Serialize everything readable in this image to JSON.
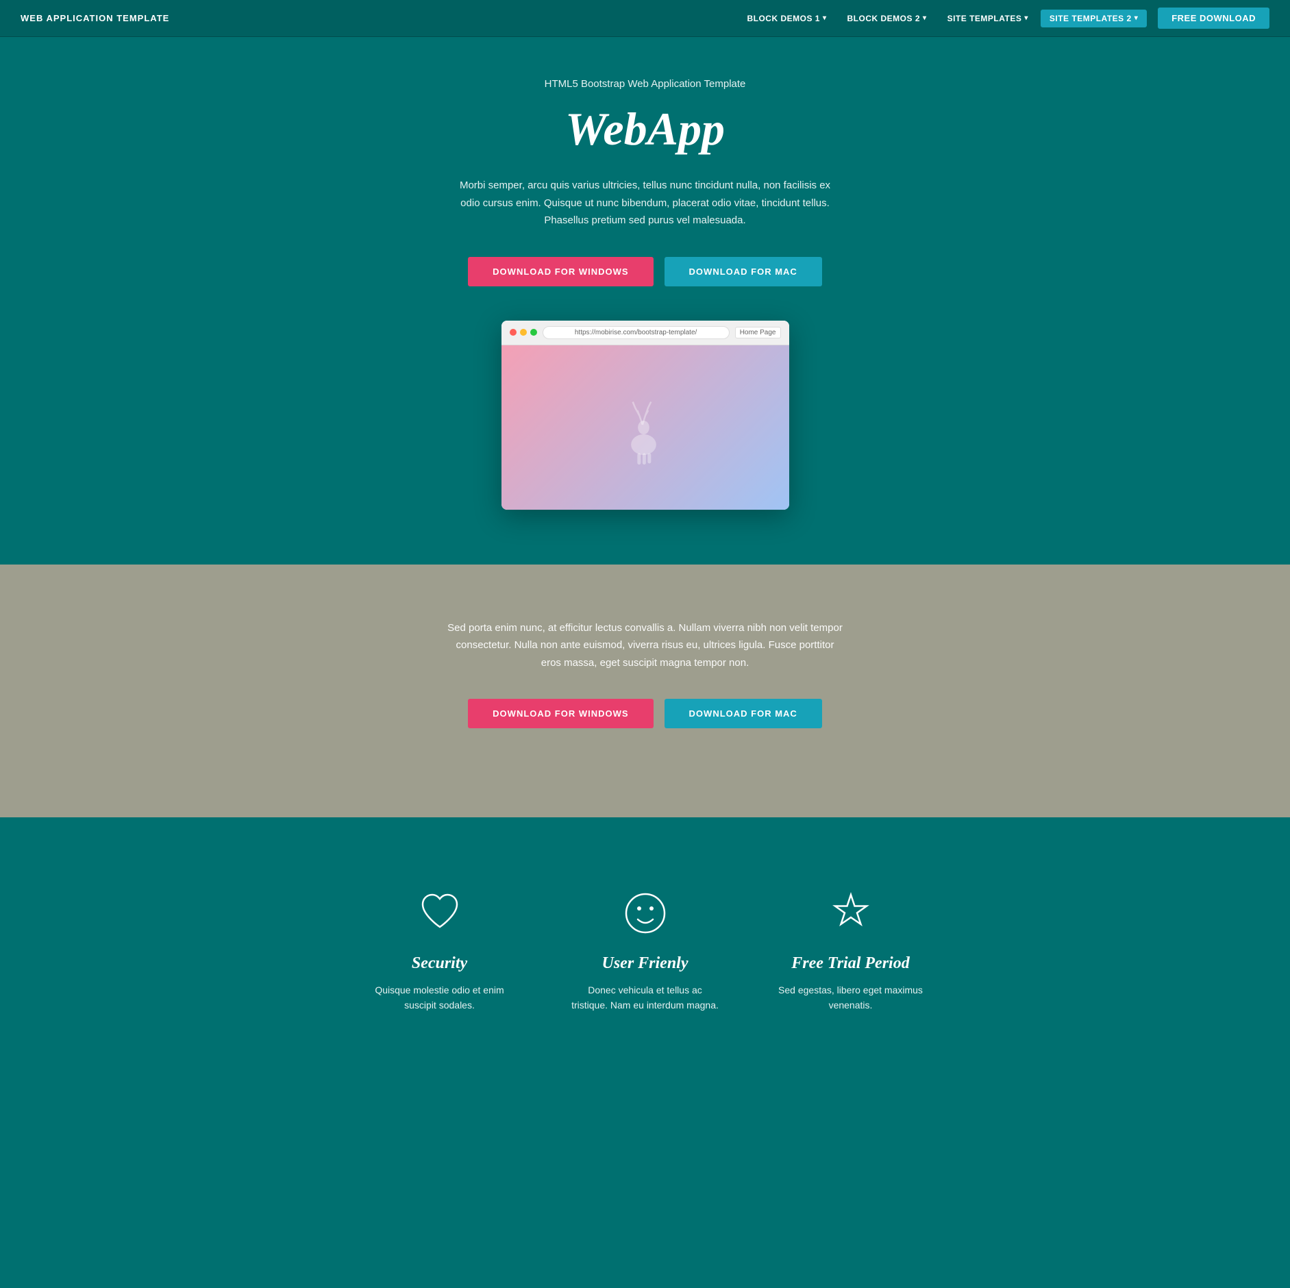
{
  "navbar": {
    "brand": "WEB APPLICATION TEMPLATE",
    "items": [
      {
        "label": "BLOCK DEMOS 1",
        "active": false
      },
      {
        "label": "BLOCK DEMOS 2",
        "active": false
      },
      {
        "label": "SITE TEMPLATES",
        "active": false
      },
      {
        "label": "SITE TEMPLATES 2",
        "active": true
      }
    ],
    "free_download": "FREE DOWNLOAD"
  },
  "hero": {
    "subtitle": "HTML5 Bootstrap Web Application Template",
    "title": "WebApp",
    "description": "Morbi semper, arcu quis varius ultricies, tellus nunc tincidunt nulla, non facilisis ex odio cursus enim. Quisque ut nunc bibendum, placerat odio vitae, tincidunt tellus. Phasellus pretium sed purus vel malesuada.",
    "btn_windows": "DOWNLOAD FOR WINDOWS",
    "btn_mac": "DOWNLOAD FOR MAC",
    "browser_url": "https://mobirise.com/bootstrap-template/",
    "browser_home": "Home Page"
  },
  "gray_section": {
    "description": "Sed porta enim nunc, at efficitur lectus convallis a. Nullam viverra nibh non velit tempor consectetur. Nulla non ante euismod, viverra risus eu, ultrices ligula. Fusce porttitor eros massa, eget suscipit magna tempor non.",
    "btn_windows": "DOWNLOAD FOR WINDOWS",
    "btn_mac": "DOWNLOAD FOR MAC"
  },
  "features": [
    {
      "icon": "heart",
      "title": "Security",
      "description": "Quisque molestie odio et enim suscipit sodales."
    },
    {
      "icon": "smile",
      "title": "User Frienly",
      "description": "Donec vehicula et tellus ac tristique. Nam eu interdum magna."
    },
    {
      "icon": "star",
      "title": "Free Trial Period",
      "description": "Sed egestas, libero eget maximus venenatis."
    }
  ]
}
